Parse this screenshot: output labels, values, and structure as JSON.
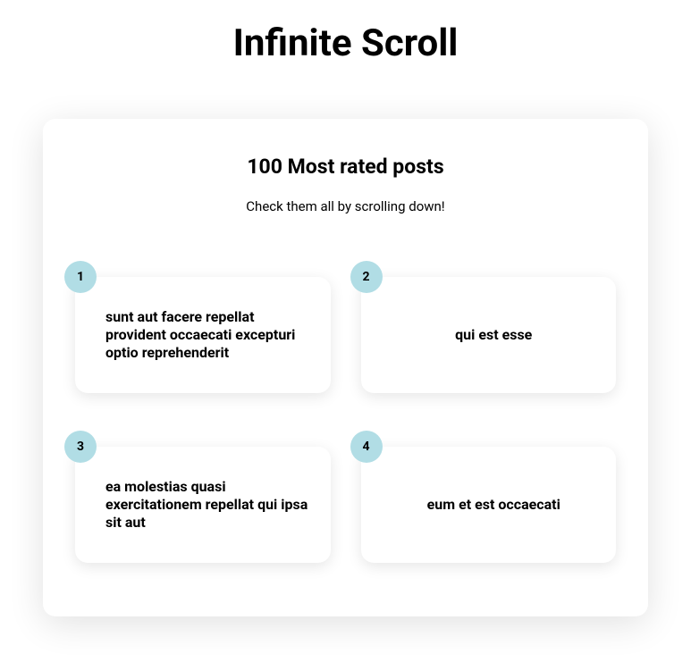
{
  "page": {
    "title": "Infinite Scroll"
  },
  "section": {
    "title": "100 Most rated posts",
    "subtitle": "Check them all by scrolling down!"
  },
  "posts": [
    {
      "id": "1",
      "title": "sunt aut facere repellat provident occaecati excepturi optio reprehenderit"
    },
    {
      "id": "2",
      "title": "qui est esse"
    },
    {
      "id": "3",
      "title": "ea molestias quasi exercitationem repellat qui ipsa sit aut"
    },
    {
      "id": "4",
      "title": "eum et est occaecati"
    }
  ]
}
